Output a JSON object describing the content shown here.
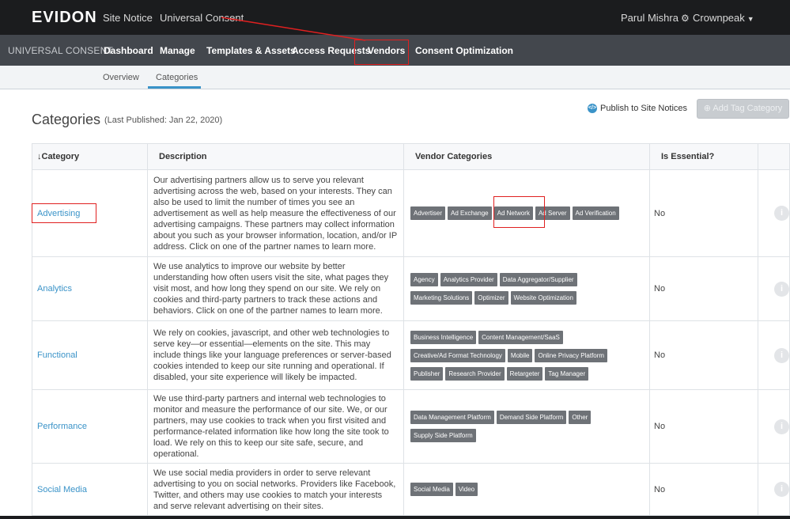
{
  "topbar": {
    "logo": "EVIDON",
    "links": [
      "Site Notice",
      "Universal Consent"
    ],
    "user": "Parul Mishra",
    "org": "Crownpeak",
    "icons": {
      "user_settings": "gear-icon",
      "org_menu": "caret-down-icon"
    }
  },
  "nav": {
    "brand": "UNIVERSAL CONSENT",
    "items": [
      "Dashboard",
      "Manage",
      "Templates & Assets",
      "Access Requests",
      "Vendors",
      "Consent Optimization"
    ]
  },
  "subtabs": {
    "items": [
      "Overview",
      "Categories"
    ],
    "active": "Categories"
  },
  "header": {
    "title": "Categories",
    "published": "(Last Published: Jan 22, 2020)",
    "publish_label": "Publish to Site Notices",
    "publish_icon": "code-icon",
    "add_label": "Add Tag Category",
    "add_icon": "plus-circle-icon"
  },
  "table": {
    "columns": [
      "Category",
      "Description",
      "Vendor Categories",
      "Is Essential?"
    ],
    "sort_icon": "arrow-down-icon",
    "rows": [
      {
        "category": "Advertising",
        "description": "Our advertising partners allow us to serve you relevant advertising across the web, based on your interests. They can also be used to limit the number of times you see an advertisement as well as help measure the effectiveness of our advertising campaigns. These partners may collect information about you such as your browser information, location, and/or IP address. Click on one of the partner names to learn more.",
        "vendors": [
          "Advertiser",
          "Ad Exchange",
          "Ad Network",
          "Ad Server",
          "Ad Verification"
        ],
        "essential": "No"
      },
      {
        "category": "Analytics",
        "description": "We use analytics to improve our website by better understanding how often users visit the site, what pages they visit most, and how long they spend on our site. We rely on cookies and third-party partners to track these actions and behaviors. Click on one of the partner names to learn more.",
        "vendors": [
          "Agency",
          "Analytics Provider",
          "Data Aggregator/Supplier",
          "Marketing Solutions",
          "Optimizer",
          "Website Optimization"
        ],
        "essential": "No"
      },
      {
        "category": "Functional",
        "description": "We rely on cookies, javascript, and other web technologies to serve key—or essential—elements on the site. This may include things like your language preferences or server-based cookies intended to keep our site running and operational. If disabled, your site experience will likely be impacted.",
        "vendors": [
          "Business Intelligence",
          "Content Management/SaaS",
          "Creative/Ad Format Technology",
          "Mobile",
          "Online Privacy Platform",
          "Publisher",
          "Research Provider",
          "Retargeter",
          "Tag Manager"
        ],
        "essential": "No"
      },
      {
        "category": "Performance",
        "description": "We use third-party partners and internal web technologies to monitor and measure the performance of our site. We, or our partners, may use cookies to track when you first visited and performance-related information like how long the site took to load. We rely on this to keep our site safe, secure, and operational.",
        "vendors": [
          "Data Management Platform",
          "Demand Side Platform",
          "Other",
          "Supply Side Platform"
        ],
        "essential": "No"
      },
      {
        "category": "Social Media",
        "description": "We use social media providers in order to serve relevant advertising to you on social networks. Providers like Facebook, Twitter, and others may use cookies to match your interests and serve relevant advertising on their sites.",
        "vendors": [
          "Social Media",
          "Video"
        ],
        "essential": "No"
      }
    ]
  },
  "annotation_color": "#e02020"
}
